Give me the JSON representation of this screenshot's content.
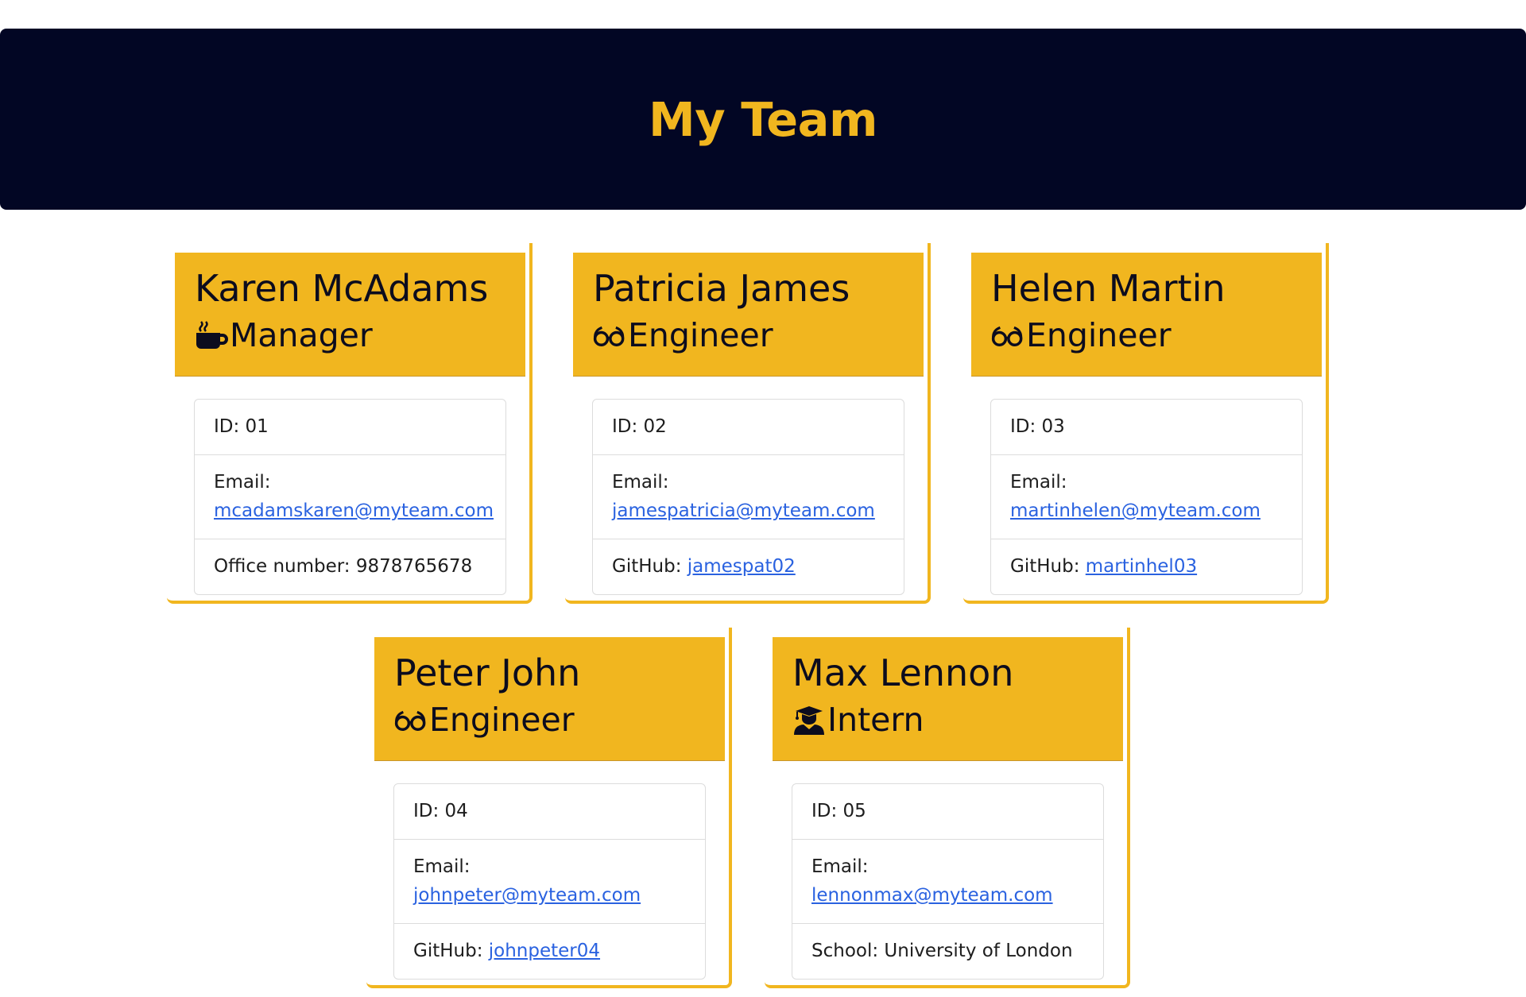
{
  "header": {
    "title": "My Team"
  },
  "team": [
    {
      "name": "Karen McAdams",
      "role": "Manager",
      "role_icon": "coffee-mug-icon",
      "id_label": "ID: 01",
      "email_label": "Email:",
      "email": "mcadamskaren@myteam.com",
      "extra_label": "Office number: 9878765678",
      "extra_link": ""
    },
    {
      "name": "Patricia James",
      "role": "Engineer",
      "role_icon": "glasses-icon",
      "id_label": "ID: 02",
      "email_label": "Email:",
      "email": "jamespatricia@myteam.com",
      "extra_label": "GitHub:",
      "extra_link": "jamespat02"
    },
    {
      "name": "Helen Martin",
      "role": "Engineer",
      "role_icon": "glasses-icon",
      "id_label": "ID: 03",
      "email_label": "Email:",
      "email": "martinhelen@myteam.com",
      "extra_label": "GitHub:",
      "extra_link": "martinhel03"
    },
    {
      "name": "Peter John",
      "role": "Engineer",
      "role_icon": "glasses-icon",
      "id_label": "ID: 04",
      "email_label": "Email:",
      "email": "johnpeter@myteam.com",
      "extra_label": "GitHub:",
      "extra_link": "johnpeter04"
    },
    {
      "name": "Max Lennon",
      "role": "Intern",
      "role_icon": "graduate-icon",
      "id_label": "ID: 05",
      "email_label": "Email:",
      "email": "lennonmax@myteam.com",
      "extra_label": "School: University of London",
      "extra_link": ""
    }
  ],
  "colors": {
    "header_bg": "#020624",
    "accent": "#f1b61f",
    "link": "#2a62e0"
  }
}
